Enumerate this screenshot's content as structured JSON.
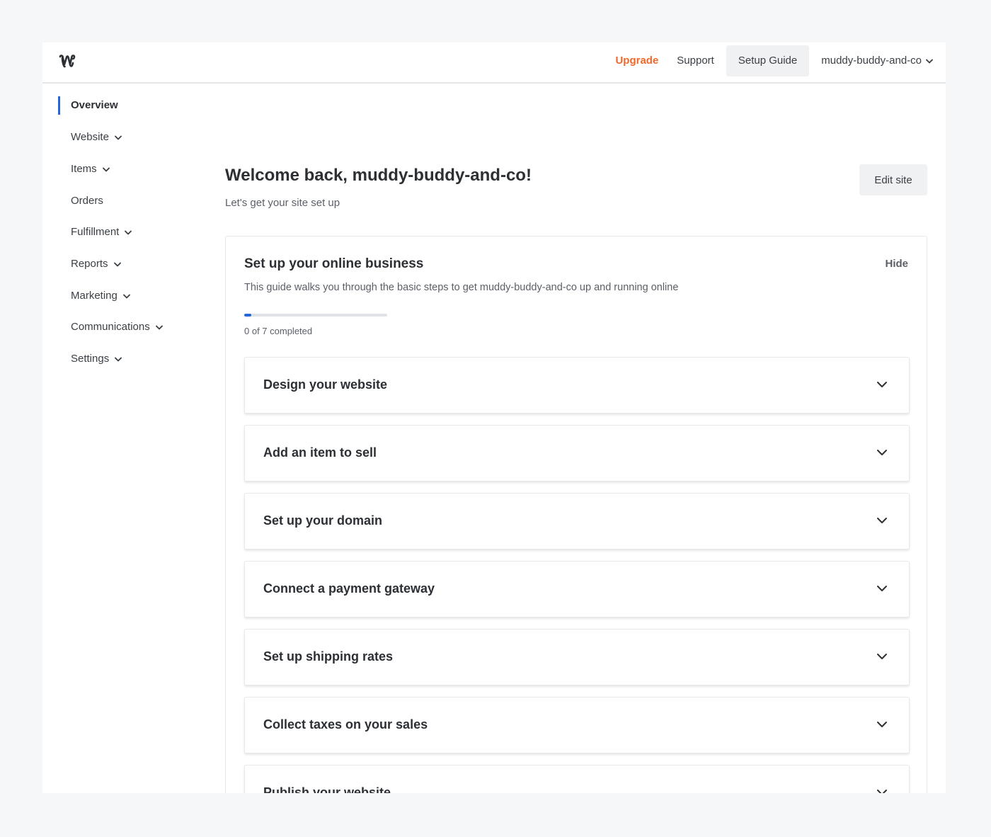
{
  "topbar": {
    "logo_icon": "weebly-w-icon",
    "upgrade": "Upgrade",
    "support": "Support",
    "setup_guide": "Setup Guide",
    "account": "muddy-buddy-and-co",
    "accent_color": "#f0682a"
  },
  "sidebar": {
    "items": [
      {
        "label": "Overview",
        "active": true,
        "has_dropdown": false
      },
      {
        "label": "Website",
        "active": false,
        "has_dropdown": true
      },
      {
        "label": "Items",
        "active": false,
        "has_dropdown": true
      },
      {
        "label": "Orders",
        "active": false,
        "has_dropdown": false
      },
      {
        "label": "Fulfillment",
        "active": false,
        "has_dropdown": true
      },
      {
        "label": "Reports",
        "active": false,
        "has_dropdown": true
      },
      {
        "label": "Marketing",
        "active": false,
        "has_dropdown": true
      },
      {
        "label": "Communications",
        "active": false,
        "has_dropdown": true
      },
      {
        "label": "Settings",
        "active": false,
        "has_dropdown": true
      }
    ],
    "active_color": "#2566db"
  },
  "main": {
    "welcome": "Welcome back, muddy-buddy-and-co!",
    "subtitle": "Let's get your site set up",
    "edit_site": "Edit site"
  },
  "guide": {
    "title": "Set up your online business",
    "description": "This guide walks you through the basic steps to get muddy-buddy-and-co up and running online",
    "hide": "Hide",
    "progress_text": "0 of 7 completed",
    "progress_fraction": 0.05,
    "steps": [
      {
        "label": "Design your website"
      },
      {
        "label": "Add an item to sell"
      },
      {
        "label": "Set up your domain"
      },
      {
        "label": "Connect a payment gateway"
      },
      {
        "label": "Set up shipping rates"
      },
      {
        "label": "Collect taxes on your sales"
      },
      {
        "label": "Publish your website"
      }
    ]
  }
}
